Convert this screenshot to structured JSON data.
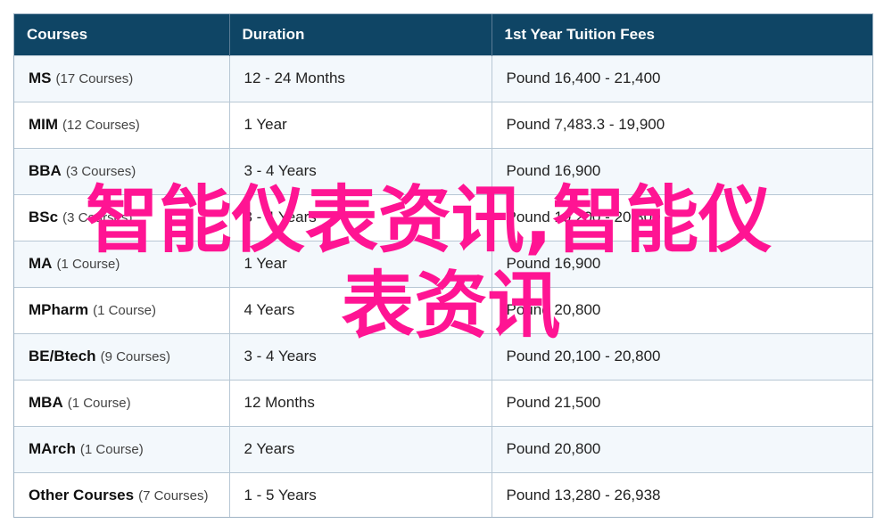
{
  "table": {
    "headers": [
      "Courses",
      "Duration",
      "1st Year Tuition Fees"
    ],
    "rows": [
      {
        "name": "MS",
        "count": "(17 Courses)",
        "duration": "12 - 24 Months",
        "fees": "Pound 16,400 - 21,400"
      },
      {
        "name": "MIM",
        "count": "(12 Courses)",
        "duration": "1 Year",
        "fees": "Pound 7,483.3 - 19,900"
      },
      {
        "name": "BBA",
        "count": "(3 Courses)",
        "duration": "3 - 4 Years",
        "fees": "Pound 16,900"
      },
      {
        "name": "BSc",
        "count": "(3 Courses)",
        "duration": "3 - 4 Years",
        "fees": "Pound 19,200 - 20,800"
      },
      {
        "name": "MA",
        "count": "(1 Course)",
        "duration": "1 Year",
        "fees": "Pound 16,900"
      },
      {
        "name": "MPharm",
        "count": "(1 Course)",
        "duration": "4 Years",
        "fees": "Pound 20,800"
      },
      {
        "name": "BE/Btech",
        "count": "(9 Courses)",
        "duration": "3 - 4 Years",
        "fees": "Pound 20,100 - 20,800"
      },
      {
        "name": "MBA",
        "count": "(1 Course)",
        "duration": "12 Months",
        "fees": "Pound 21,500"
      },
      {
        "name": "MArch",
        "count": "(1 Course)",
        "duration": "2 Years",
        "fees": "Pound 20,800"
      },
      {
        "name": "Other Courses",
        "count": "(7 Courses)",
        "duration": "1 - 5 Years",
        "fees": "Pound 13,280 - 26,938"
      }
    ]
  },
  "watermark": {
    "line1": "智能仪表资讯,智能仪",
    "line2": "表资讯"
  },
  "colors": {
    "header_bg": "#0f4565",
    "watermark": "#ff1493",
    "row_alt": "#f3f8fc"
  }
}
